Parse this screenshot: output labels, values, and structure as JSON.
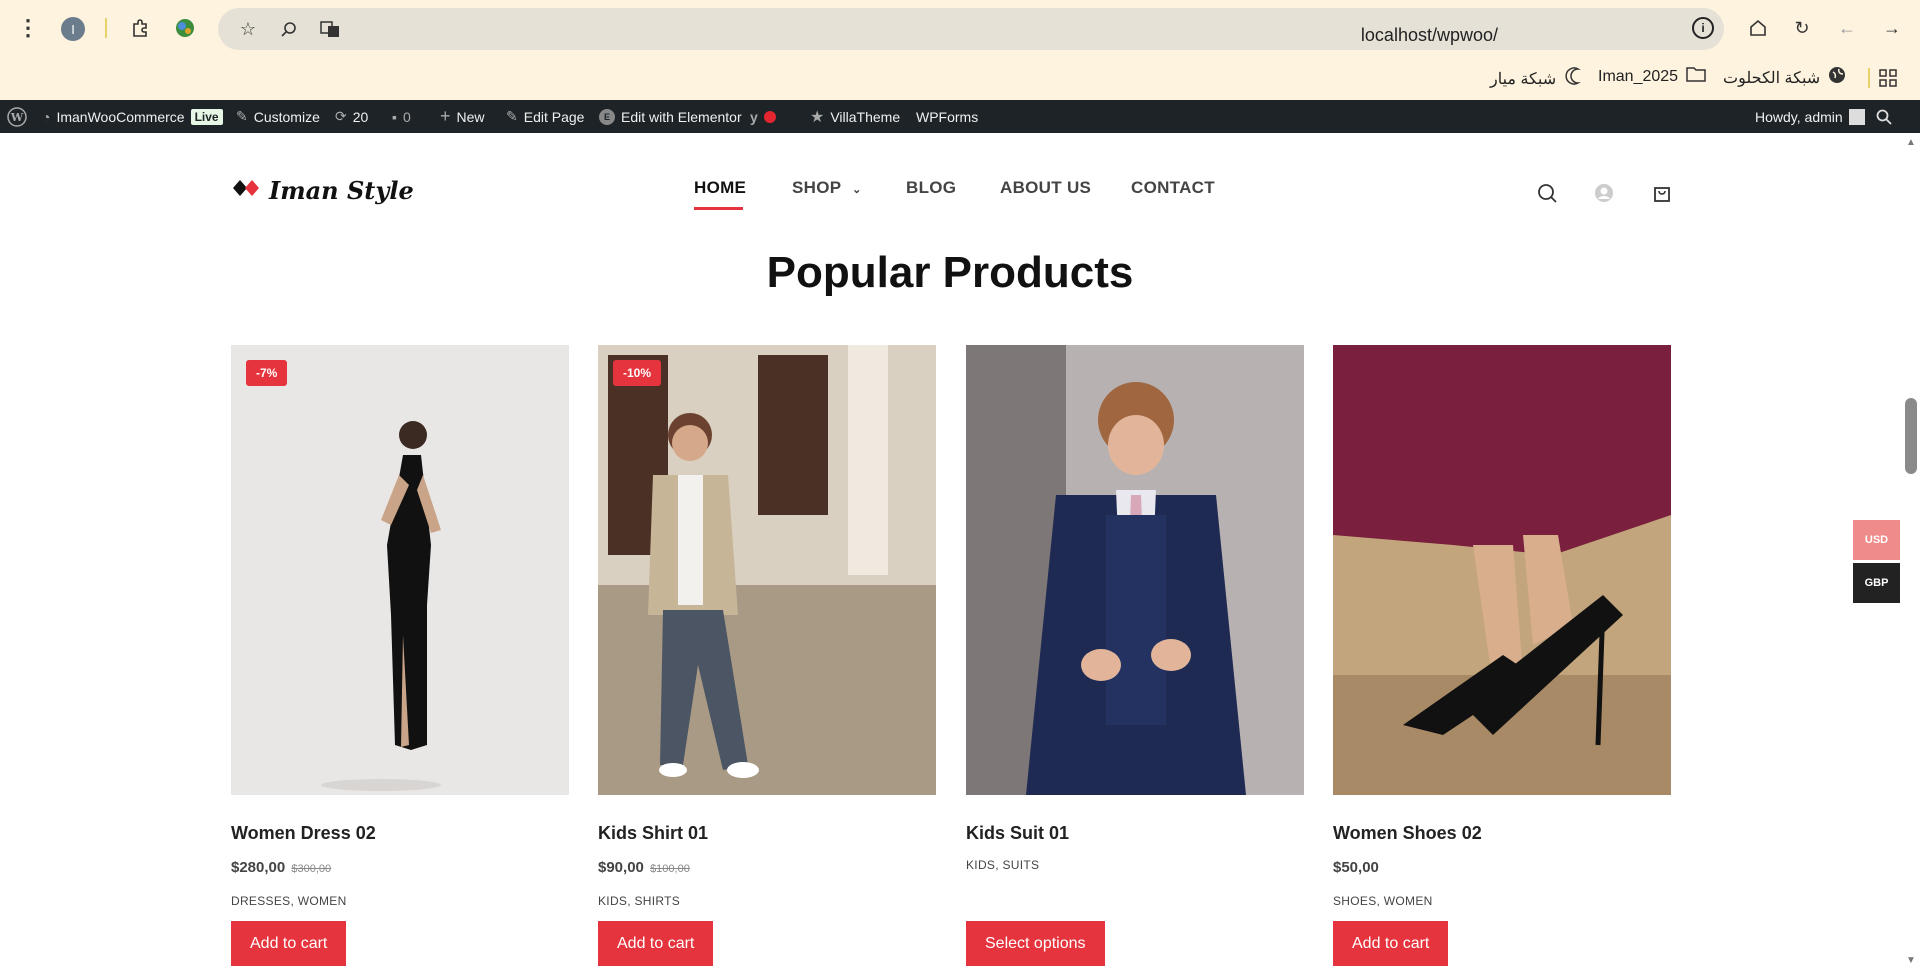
{
  "browser": {
    "profile_initial": "I",
    "url": "localhost/wpwoo/",
    "info_symbol": "i"
  },
  "bookmarks": [
    {
      "label": "شبكة الكحلوت"
    },
    {
      "label": "Iman_2025"
    },
    {
      "label": "شبكة ميار"
    }
  ],
  "wpbar": {
    "site_name": "ImanWooCommerce",
    "live_label": "Live",
    "customize": "Customize",
    "updates_count": "20",
    "comments_count": "0",
    "new": "New",
    "edit_page": "Edit Page",
    "edit_elementor": "Edit with Elementor",
    "villatheme": "VillaTheme",
    "wpforms": "WPForms",
    "howdy": "Howdy, admin"
  },
  "site": {
    "logo_text": "Iman Style",
    "nav": [
      {
        "label": "HOME",
        "active": true
      },
      {
        "label": "SHOP"
      },
      {
        "label": "BLOG"
      },
      {
        "label": "ABOUT US"
      },
      {
        "label": "CONTACT"
      }
    ]
  },
  "section_title": "Popular Products",
  "products": [
    {
      "name": "Women Dress 02",
      "badge": "-7%",
      "price": "$280,00",
      "old_price": "$300,00",
      "categories": "DRESSES, WOMEN",
      "button": "Add to cart"
    },
    {
      "name": "Kids Shirt 01",
      "badge": "-10%",
      "price": "$90,00",
      "old_price": "$100,00",
      "categories": "KIDS, SHIRTS",
      "button": "Add to cart"
    },
    {
      "name": "Kids Suit 01",
      "badge": "",
      "price": "",
      "old_price": "",
      "categories": "KIDS, SUITS",
      "button": "Select options"
    },
    {
      "name": "Women Shoes 02",
      "badge": "",
      "price": "$50,00",
      "old_price": "",
      "categories": "SHOES, WOMEN",
      "button": "Add to cart"
    }
  ],
  "currency": [
    {
      "code": "USD",
      "color": "#f08b8b"
    },
    {
      "code": "GBP",
      "color": "#222222"
    }
  ],
  "colors": {
    "accent": "#e5343d",
    "admin_bar": "#1d2327",
    "browser_bg": "#fdf3df"
  }
}
